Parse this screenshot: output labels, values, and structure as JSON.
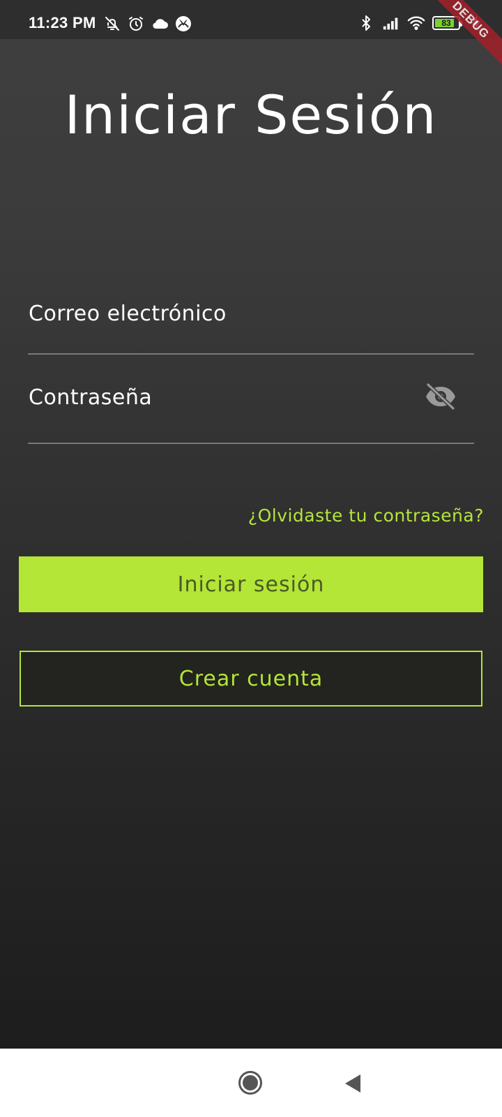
{
  "status_bar": {
    "time": "11:23 PM",
    "battery_percent": "83",
    "battery_level": 0.83,
    "left_icons": [
      "bell-off-icon",
      "alarm-icon",
      "cloud-icon",
      "xbox-icon"
    ],
    "right_icons": [
      "bluetooth-icon",
      "signal-icon",
      "wifi-icon",
      "battery-icon",
      "charging-icon"
    ]
  },
  "debug_banner": "DEBUG",
  "login": {
    "title": "Iniciar Sesión",
    "email_label": "Correo electrónico",
    "password_label": "Contraseña",
    "password_visibility_icon": "eye-off-icon",
    "forgot_password": "¿Olvidaste tu contraseña?",
    "login_button": "Iniciar sesión",
    "create_account_button": "Crear cuenta"
  },
  "colors": {
    "accent": "#b3e636",
    "background_top": "#3f3f3f",
    "background_bottom": "#1d1d1d"
  },
  "nav_bar": {
    "icons": [
      "home-icon",
      "back-icon"
    ]
  }
}
